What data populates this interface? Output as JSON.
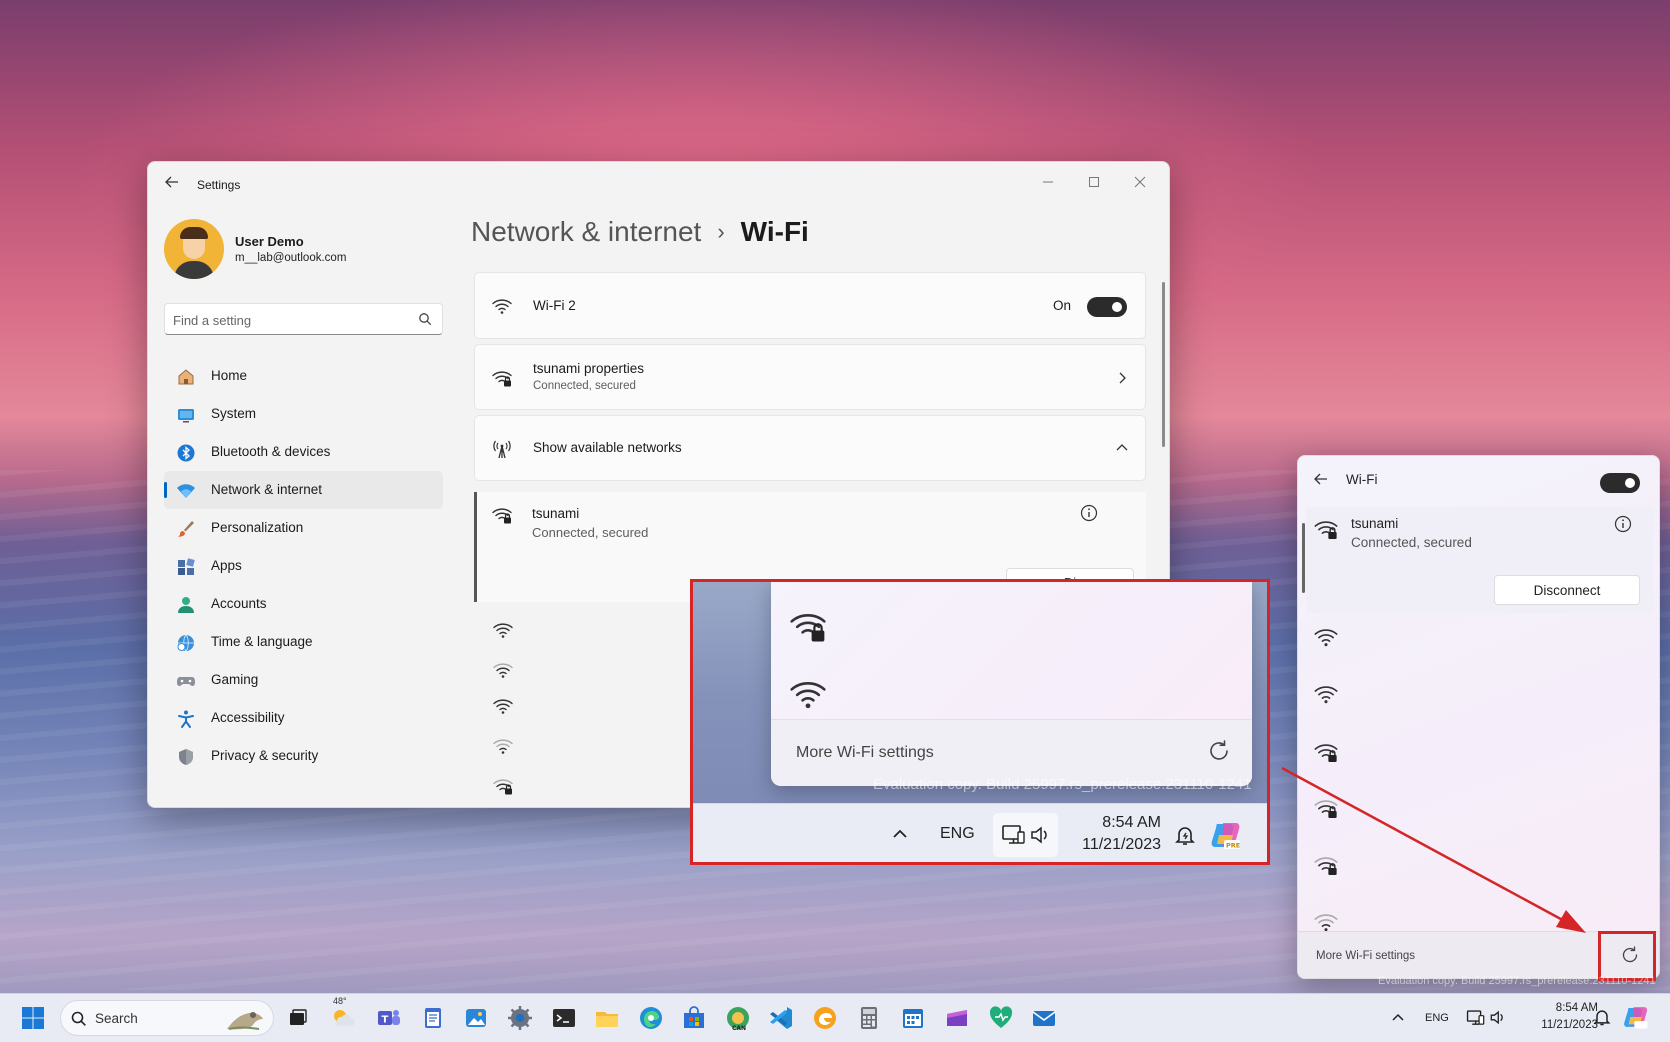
{
  "window": {
    "title": "Settings",
    "user_name": "User Demo",
    "user_email": "m__lab@outlook.com",
    "search_placeholder": "Find a setting"
  },
  "nav": [
    {
      "label": "Home",
      "icon": "home-icon"
    },
    {
      "label": "System",
      "icon": "system-icon"
    },
    {
      "label": "Bluetooth & devices",
      "icon": "bluetooth-icon"
    },
    {
      "label": "Network & internet",
      "icon": "network-icon",
      "active": true
    },
    {
      "label": "Personalization",
      "icon": "brush-icon"
    },
    {
      "label": "Apps",
      "icon": "apps-icon"
    },
    {
      "label": "Accounts",
      "icon": "accounts-icon"
    },
    {
      "label": "Time & language",
      "icon": "globe-clock-icon"
    },
    {
      "label": "Gaming",
      "icon": "gamepad-icon"
    },
    {
      "label": "Accessibility",
      "icon": "accessibility-icon"
    },
    {
      "label": "Privacy & security",
      "icon": "shield-icon"
    }
  ],
  "breadcrumb": {
    "parent": "Network & internet",
    "separator": "›",
    "current": "Wi-Fi"
  },
  "wifi_card": {
    "label": "Wi-Fi 2",
    "state": "On"
  },
  "properties_card": {
    "title": "tsunami properties",
    "subtitle": "Connected, secured"
  },
  "networks_card": {
    "label": "Show available networks"
  },
  "connected_network": {
    "name": "tsunami",
    "status": "Connected, secured",
    "button_partial": "Di"
  },
  "zoom": {
    "more_settings": "More Wi-Fi settings",
    "eval_text": "Evaluation copy. Build 25997.rs_prerelease.231110-1241",
    "lang": "ENG",
    "time": "8:54 AM",
    "date": "11/21/2023"
  },
  "flyout": {
    "title": "Wi-Fi",
    "network_name": "tsunami",
    "network_status": "Connected, secured",
    "disconnect_label": "Disconnect",
    "more_settings": "More Wi-Fi settings",
    "eval_text": "Evaluation copy. Build 25997.rs_prerelease.231110-1241"
  },
  "taskbar": {
    "search_label": "Search",
    "weather": "48°",
    "lang": "ENG",
    "time": "8:54 AM",
    "date": "11/21/2023"
  },
  "colors": {
    "accent": "#0067c0",
    "callout": "#d42626",
    "toggle_on": "#2b2b2b"
  }
}
